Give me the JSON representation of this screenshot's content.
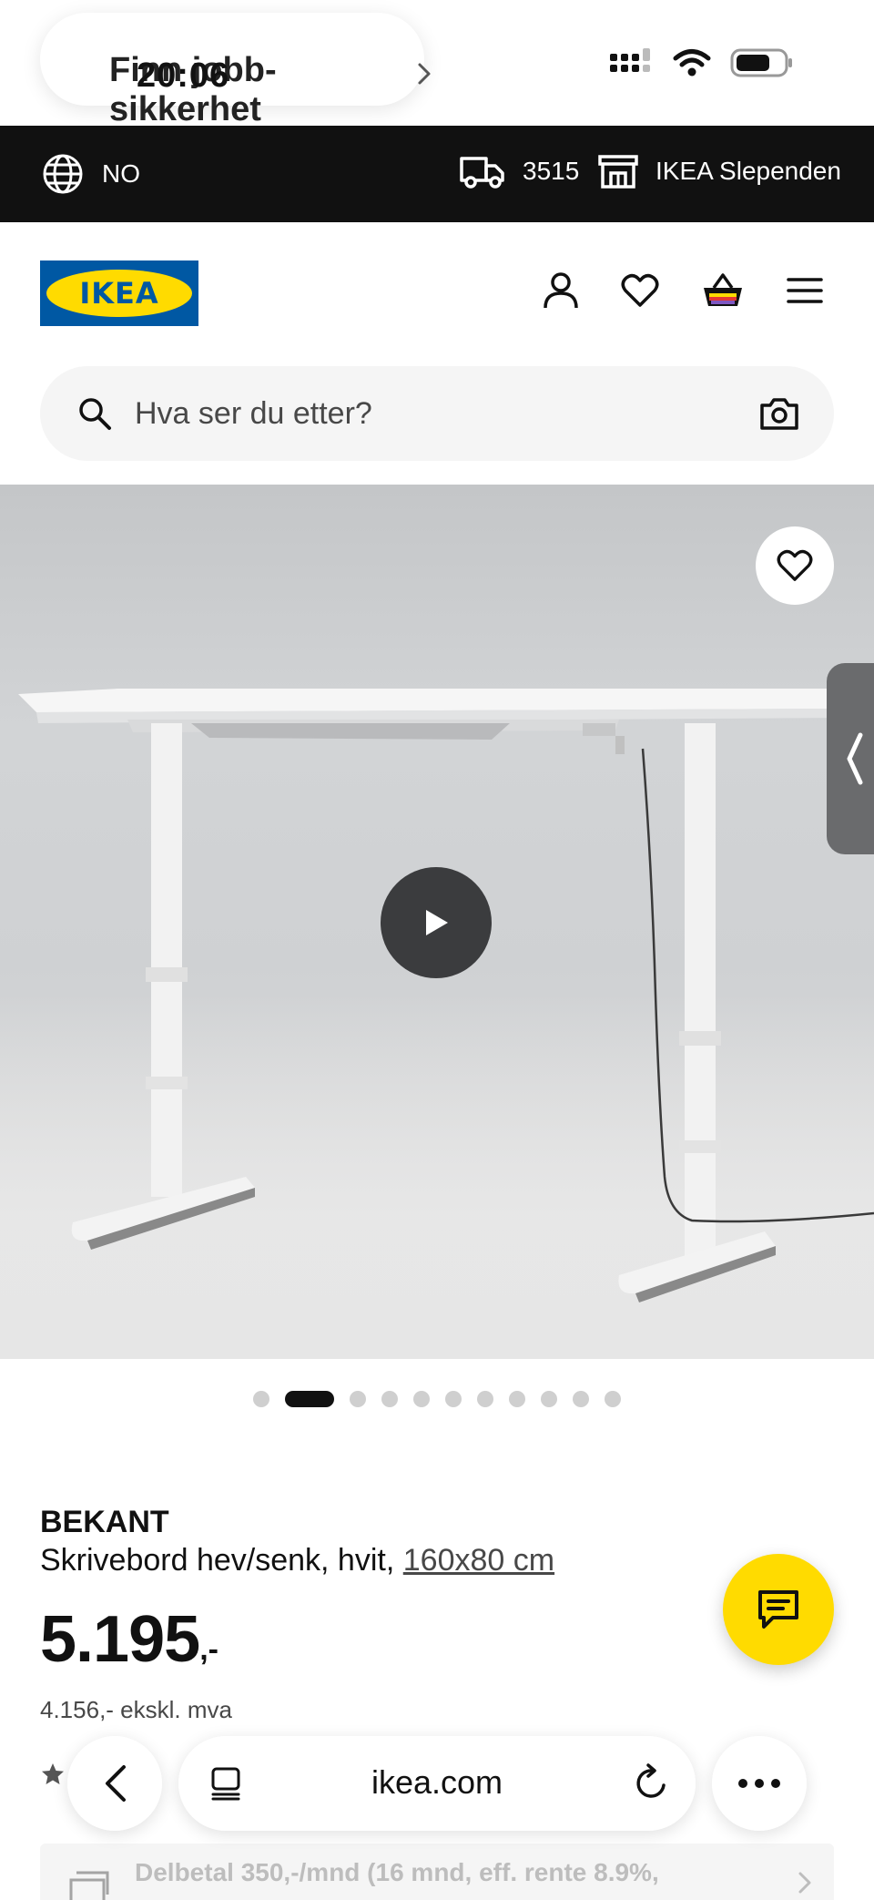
{
  "status_bar": {
    "time": "20:06",
    "site_text": "Finn jobb-sikkerhet"
  },
  "topbar": {
    "language": "NO",
    "postal_code": "3515",
    "store": "IKEA Slependen"
  },
  "header": {
    "logo_text": "IKEA"
  },
  "search": {
    "placeholder": "Hva ser du etter?"
  },
  "gallery": {
    "dot_count": 11,
    "active_index": 1
  },
  "product": {
    "brand": "BEKANT",
    "description": "Skrivebord hev/senk, hvit,",
    "size_link": "160x80 cm",
    "price_main": "5.195",
    "price_suffix": ",-",
    "price_ex_vat": "4.156,- ekskl. mva"
  },
  "financing": {
    "text": "Delbetal 350,-/mnd (16 mnd, eff. rente 8.9%,"
  },
  "browser": {
    "url": "ikea.com"
  },
  "colors": {
    "ikea_blue": "#0058a3",
    "ikea_yellow": "#ffdb00",
    "topbar_bg": "#111111"
  }
}
